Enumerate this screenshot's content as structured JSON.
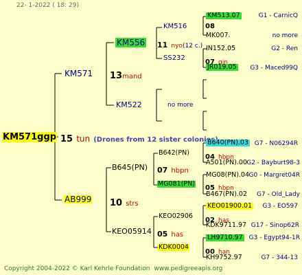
{
  "header": {
    "date": "22-  1-2022 ( 18: 29)"
  },
  "footer": {
    "copyright": "Copyright 2004-2022 © Karl Kehrle Foundation",
    "website": "www.pedigreeapis.org"
  },
  "root": {
    "id": "KM571ggp",
    "count": "15",
    "unit": "tun",
    "note": "(Drones from 12 sister colonies)"
  },
  "sire": {
    "id": "KM571",
    "count": "13",
    "unit": "mand",
    "sire": {
      "id": "KM556",
      "count": "11",
      "unit": "nyo",
      "note": "(12 c.)",
      "sire": {
        "id": "KM516",
        "count": "08",
        "children": [
          "KM513.07",
          "MK007."
        ],
        "sources": [
          "G1 - CarnicQ",
          "no more"
        ]
      },
      "dam": {
        "id": "SS232",
        "count": "07",
        "unit": "gin",
        "children": [
          "IN152.05",
          "JR019.05"
        ],
        "sources": [
          "G2 - Ren",
          "G3 - Maced99Q"
        ]
      }
    },
    "dam": {
      "id": "KM522",
      "nomore": "no more"
    }
  },
  "dam": {
    "id": "AB999",
    "count": "10",
    "unit": "strs",
    "sire": {
      "id": "B645(PN)",
      "count": "07",
      "unit": "hbpn",
      "sire": {
        "id": "B642(PN)",
        "count": "04",
        "unit": "hbpn",
        "children": [
          "B640(PN).03",
          "A501(PN).00"
        ],
        "sources": [
          "G7 - N06294R",
          "G2 - Bayburt98-3"
        ]
      },
      "dam": {
        "id": "MG081(PN)",
        "count": "05",
        "unit": "hbpn",
        "children": [
          "MG08(PN).04",
          "B467(PN).02"
        ],
        "sources": [
          "G0 - Margret04R",
          "G7 - Old_Lady"
        ]
      }
    },
    "dam": {
      "id": "KEO05914",
      "count": "05",
      "unit": "has",
      "sire": {
        "id": "KEO02906",
        "count": "02",
        "unit": "has",
        "children": [
          "KEO01900.01",
          "KDK9711.97"
        ],
        "sources": [
          "G3 - EO597",
          "G17 - Sinop62R"
        ]
      },
      "dam": {
        "id": "KDK0004",
        "count": "00",
        "unit": "han",
        "children": [
          "LH9710.97",
          "KH9752.97"
        ],
        "sources": [
          "G3 - Egypt94-1R",
          "G7 - 344-13"
        ]
      }
    }
  },
  "colors": {
    "background": "#ffffcc",
    "highlight_yellow": "#ffff00",
    "highlight_green": "#33dd33",
    "highlight_cyan": "#33dddd",
    "unit_red": "#cc0000",
    "name_blue": "#000080"
  }
}
